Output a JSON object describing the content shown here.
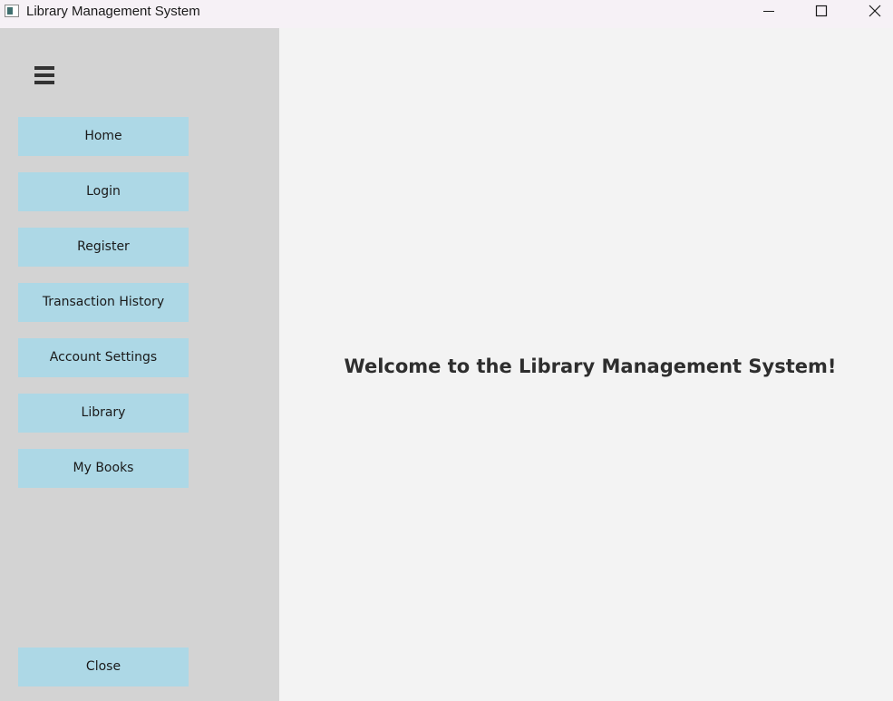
{
  "window": {
    "title": "Library Management System",
    "controls": {
      "minimize": "minimize-icon",
      "maximize": "maximize-icon",
      "close": "close-icon"
    }
  },
  "sidebar": {
    "menu_icon": "hamburger-menu-icon",
    "items": [
      {
        "label": "Home"
      },
      {
        "label": "Login"
      },
      {
        "label": "Register"
      },
      {
        "label": "Transaction History"
      },
      {
        "label": "Account Settings"
      },
      {
        "label": "Library"
      },
      {
        "label": "My Books"
      }
    ],
    "close_label": "Close"
  },
  "main": {
    "welcome_text": "Welcome to the Library Management System!"
  },
  "colors": {
    "sidebar_bg": "#d3d3d3",
    "button_bg": "#add8e6",
    "main_bg": "#f3f3f3",
    "titlebar_bg": "#f6f1f6"
  }
}
